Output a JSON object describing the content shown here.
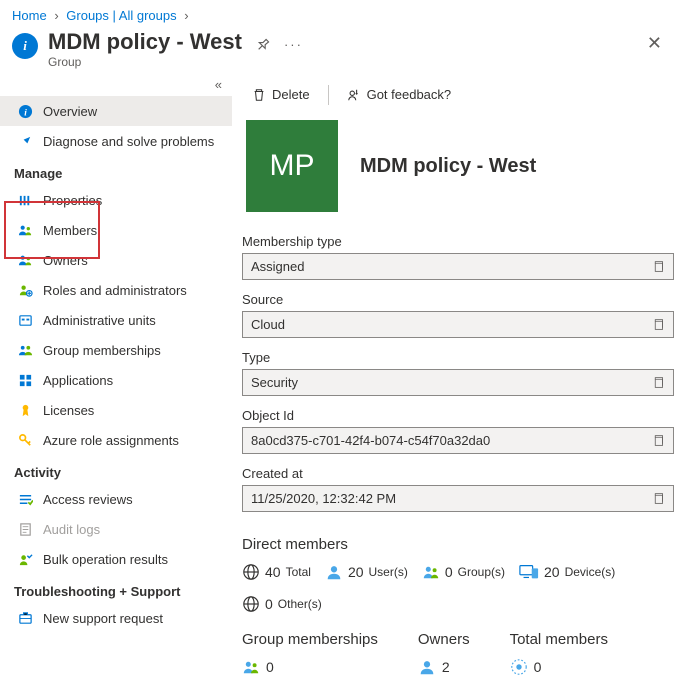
{
  "breadcrumb": {
    "home": "Home",
    "groups": "Groups | All groups"
  },
  "header": {
    "title": "MDM policy - West",
    "subtitle": "Group"
  },
  "sidebar": {
    "overview": "Overview",
    "diagnose": "Diagnose and solve problems",
    "manage_header": "Manage",
    "properties": "Properties",
    "members": "Members",
    "owners": "Owners",
    "roles": "Roles and administrators",
    "admin_units": "Administrative units",
    "group_memberships": "Group memberships",
    "applications": "Applications",
    "licenses": "Licenses",
    "azure_roles": "Azure role assignments",
    "activity_header": "Activity",
    "access_reviews": "Access reviews",
    "audit_logs": "Audit logs",
    "bulk_ops": "Bulk operation results",
    "troubleshoot_header": "Troubleshooting + Support",
    "new_support": "New support request"
  },
  "toolbar": {
    "delete": "Delete",
    "feedback": "Got feedback?"
  },
  "group": {
    "initials": "MP",
    "name": "MDM policy - West"
  },
  "fields": {
    "membership_type_label": "Membership type",
    "membership_type_value": "Assigned",
    "source_label": "Source",
    "source_value": "Cloud",
    "type_label": "Type",
    "type_value": "Security",
    "object_id_label": "Object Id",
    "object_id_value": "8a0cd375-c701-42f4-b074-c54f70a32da0",
    "created_label": "Created at",
    "created_value": "11/25/2020, 12:32:42 PM"
  },
  "direct_members": {
    "title": "Direct members",
    "total_num": "40",
    "total_lbl": "Total",
    "users_num": "20",
    "users_lbl": "User(s)",
    "groups_num": "0",
    "groups_lbl": "Group(s)",
    "devices_num": "20",
    "devices_lbl": "Device(s)",
    "others_num": "0",
    "others_lbl": "Other(s)"
  },
  "summary": {
    "gm_title": "Group memberships",
    "gm_value": "0",
    "owners_title": "Owners",
    "owners_value": "2",
    "total_title": "Total members",
    "total_value": "0"
  }
}
